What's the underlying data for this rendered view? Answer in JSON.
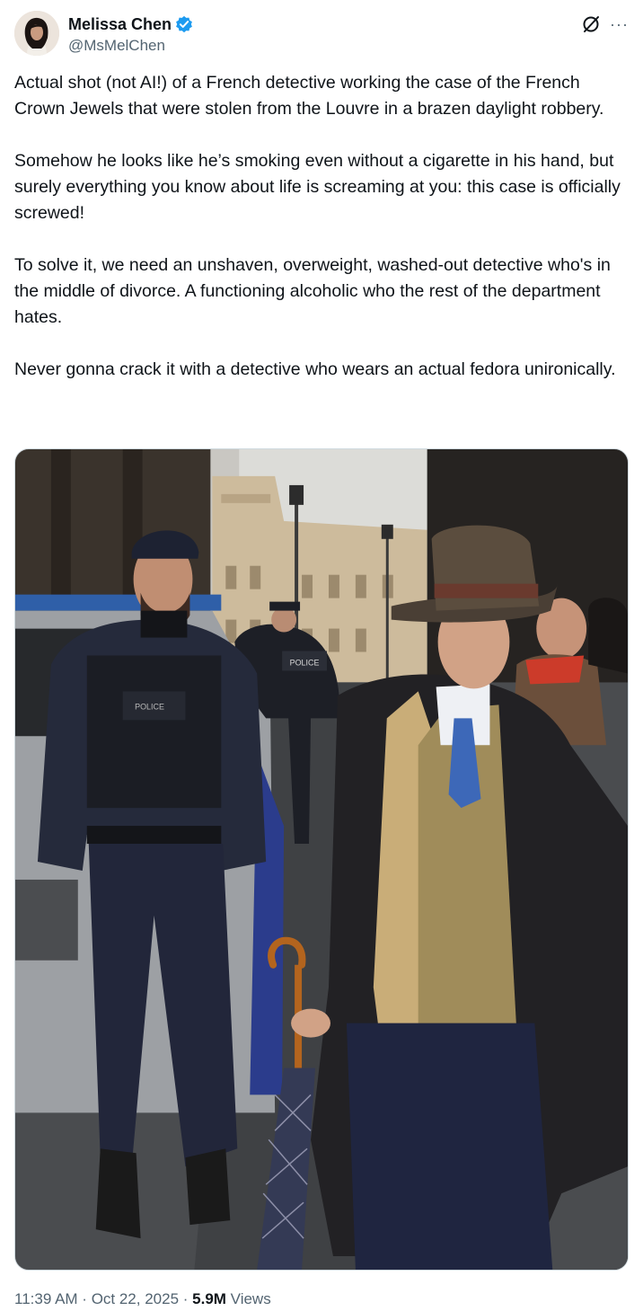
{
  "author": {
    "display_name": "Melissa Chen",
    "handle": "@MsMelChen",
    "avatar_icon": "avatar-photo",
    "verified_icon": "verified-badge-icon",
    "verified_color": "#1d9bf0"
  },
  "actions": {
    "grok_icon": "grok-icon",
    "more_icon": "more-icon",
    "more_label": "···"
  },
  "body": {
    "paragraphs": [
      "Actual shot (not AI!) of a French detective working the case of the French Crown Jewels that were stolen from the Louvre in a brazen daylight robbery.",
      "Somehow he looks like he’s smoking even without a cigarette in his hand, but surely everything you know about life is screaming at you: this case is officially screwed!",
      "To solve it, we need an unshaven, overweight, washed-out detective who's in the middle of divorce. A functioning alcoholic who the rest of the department hates.",
      "Never gonna crack it with a detective who wears an actual fedora unironically."
    ]
  },
  "photo": {
    "jacket_text": "POLICE",
    "vest_text": "POLICE"
  },
  "meta": {
    "time": "11:39 AM",
    "sep1": " · ",
    "date": "Oct 22, 2025",
    "sep2": " · ",
    "views_count": "5.9M",
    "views_label": " Views"
  }
}
